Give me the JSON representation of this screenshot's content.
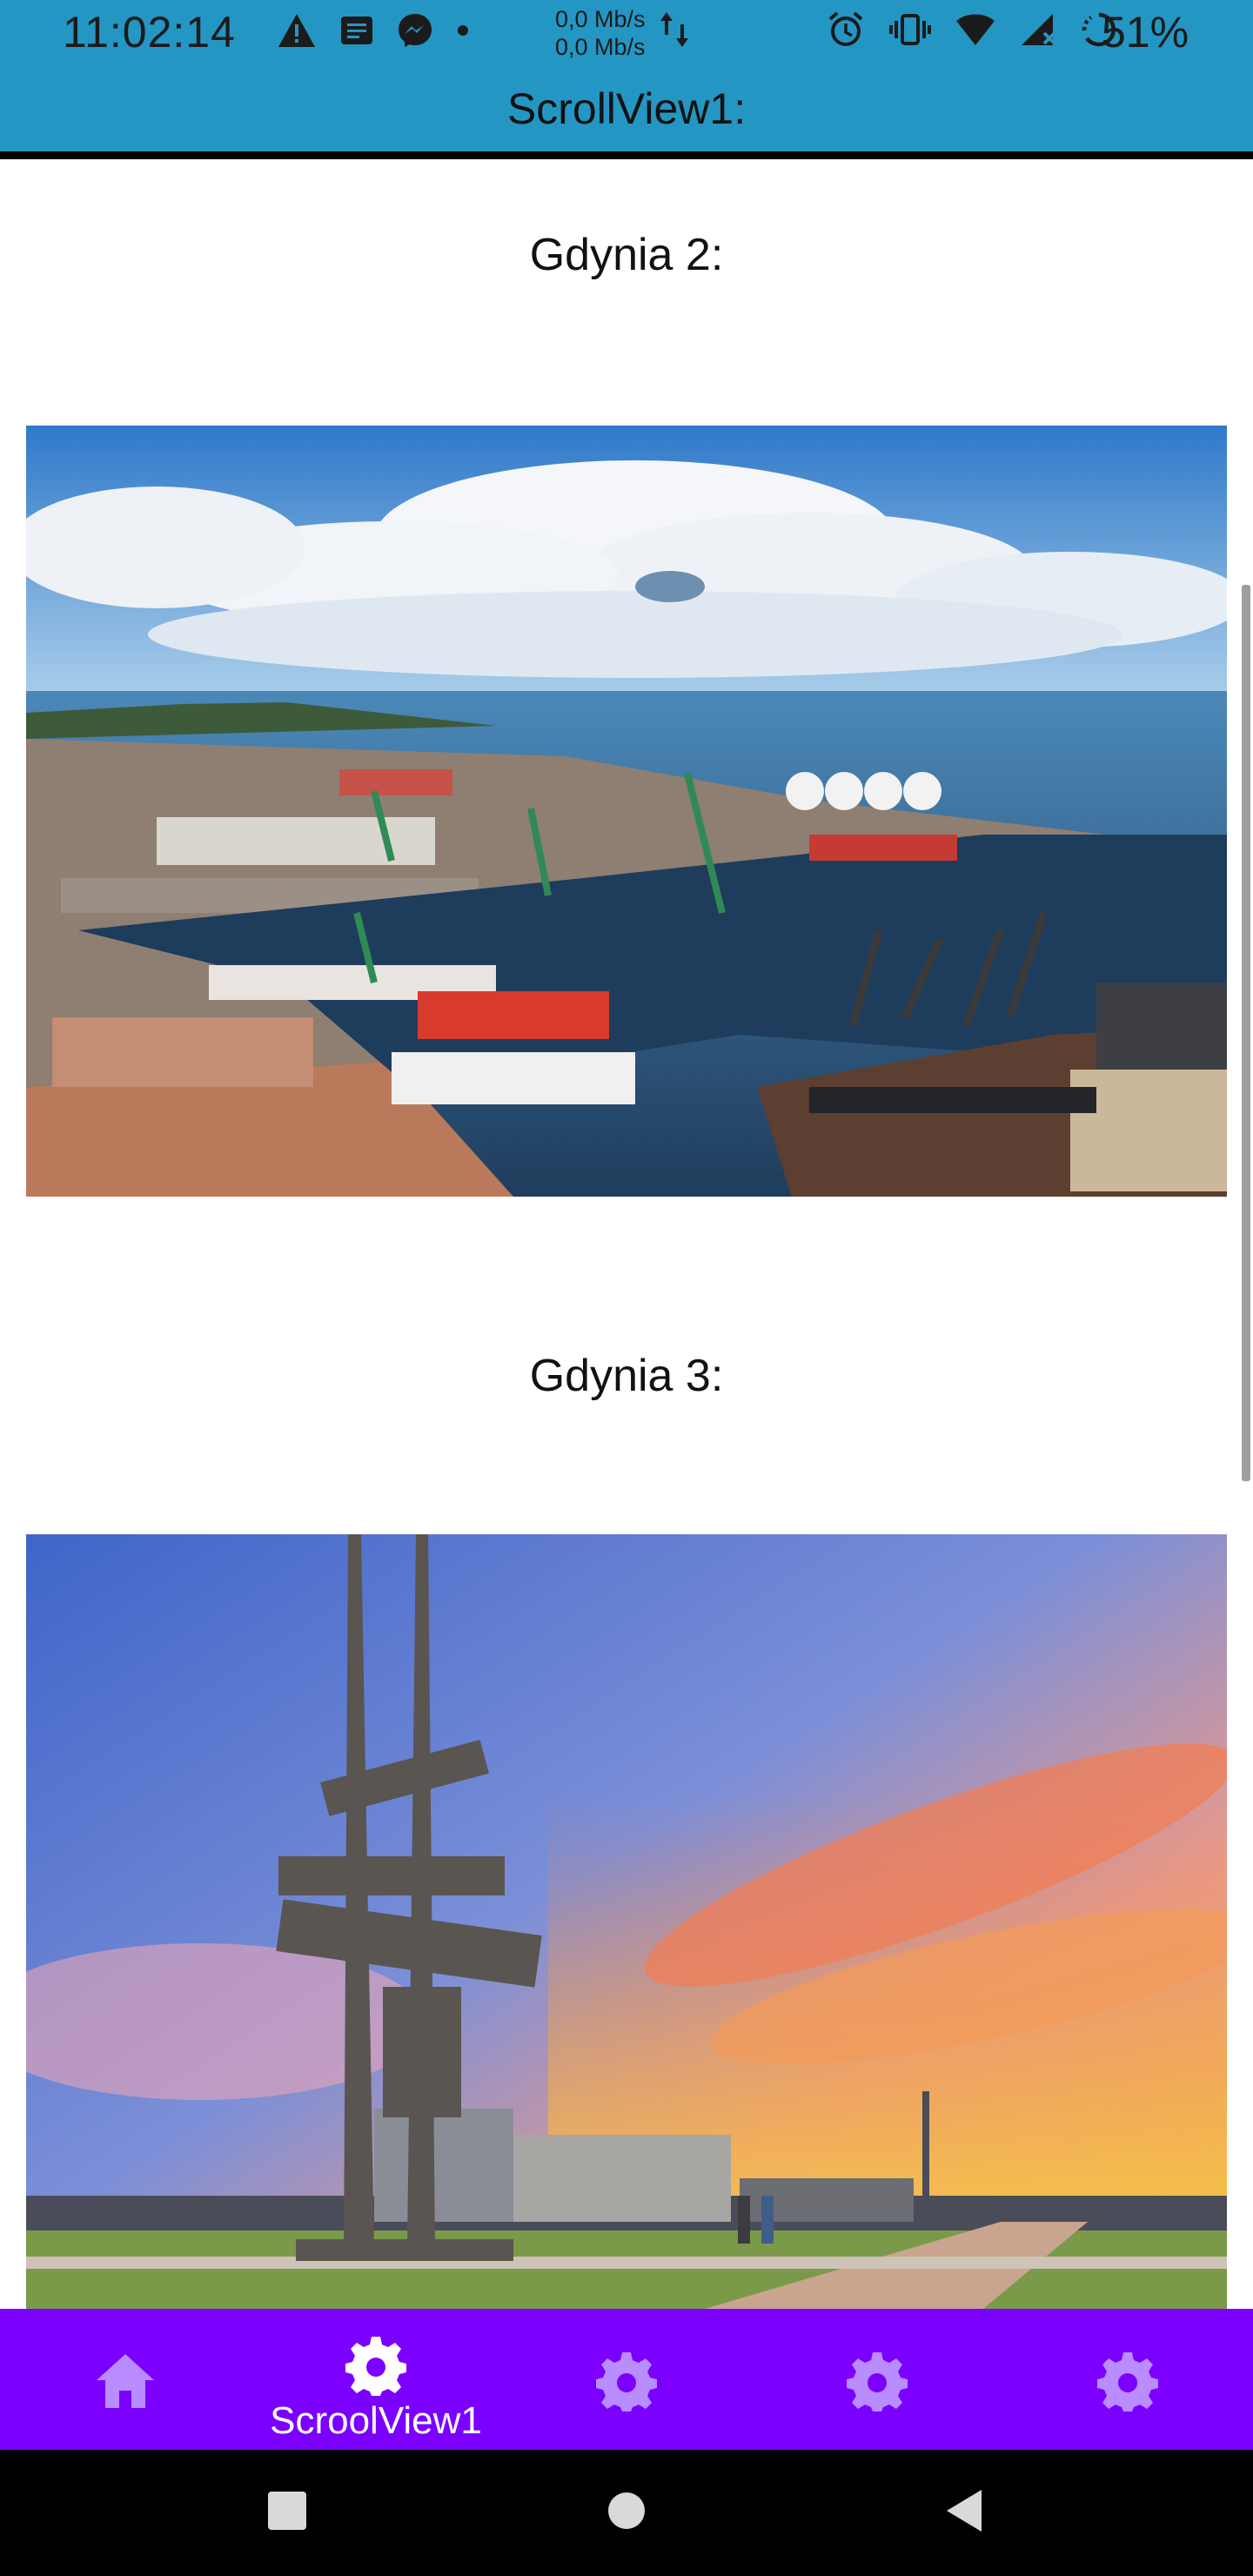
{
  "status_bar": {
    "time": "11:02:14",
    "net_speed_up": "0,0 Mb/s",
    "net_speed_down": "0,0 Mb/s",
    "battery": "51%"
  },
  "toolbar": {
    "title": "ScrollView1:"
  },
  "content": {
    "sections": [
      {
        "title": "Gdynia 2:"
      },
      {
        "title": "Gdynia 3:"
      }
    ]
  },
  "bottom_nav": {
    "items": [
      {
        "icon": "home-icon",
        "label": ""
      },
      {
        "icon": "gear-icon",
        "label": "ScroolView1",
        "selected": true
      },
      {
        "icon": "gear-icon",
        "label": ""
      },
      {
        "icon": "gear-icon",
        "label": ""
      },
      {
        "icon": "gear-icon",
        "label": ""
      }
    ]
  },
  "colors": {
    "app_bar": "#2496c3",
    "bottom_nav": "#7b00ff",
    "nav_icon_inactive": "#b98cff",
    "nav_icon_active": "#ffffff"
  }
}
